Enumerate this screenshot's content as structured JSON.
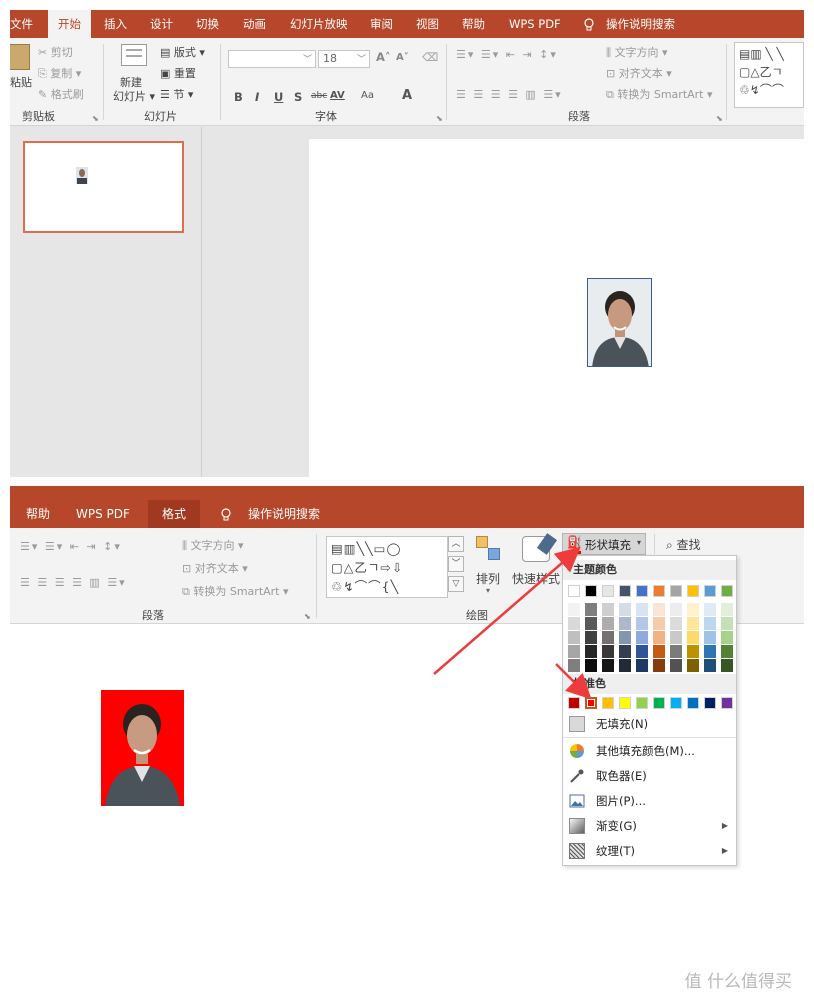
{
  "top_window": {
    "tabs": [
      "文件",
      "开始",
      "插入",
      "设计",
      "切换",
      "动画",
      "幻灯片放映",
      "审阅",
      "视图",
      "帮助",
      "WPS PDF",
      "操作说明搜索"
    ],
    "active_tab": "开始",
    "clipboard": {
      "paste": "粘贴",
      "cut": "剪切",
      "copy": "复制",
      "format_painter": "格式刷",
      "group_label": "剪贴板"
    },
    "slides_group": {
      "new_slide_line1": "新建",
      "new_slide_line2": "幻灯片",
      "layout": "版式",
      "reset": "重置",
      "section": "节",
      "group_label": "幻灯片"
    },
    "font_group": {
      "font_size": "18",
      "letters": [
        "B",
        "I",
        "U",
        "S",
        "abc",
        "AV",
        "Aa",
        "A"
      ],
      "group_label": "字体"
    },
    "paragraph_group": {
      "text_direction": "文字方向",
      "align_text": "对齐文本",
      "convert_smartart": "转换为 SmartArt",
      "group_label": "段落"
    }
  },
  "bottom_window": {
    "tabs": [
      "帮助",
      "WPS PDF",
      "格式",
      "操作说明搜索"
    ],
    "active_tab": "格式",
    "paragraph_group": {
      "text_direction": "文字方向",
      "align_text": "对齐文本",
      "convert_smartart": "转换为 SmartArt",
      "group_label": "段落"
    },
    "drawing_group": {
      "arrange": "排列",
      "quick_styles": "快速样式",
      "shape_fill": "形状填充",
      "find": "查找",
      "group_label": "绘图"
    },
    "fill_menu": {
      "theme_colors_header": "主题颜色",
      "standard_colors_header": "标准色",
      "theme_top_row": [
        "#ffffff",
        "#000000",
        "#e7e6e6",
        "#44546a",
        "#4472c4",
        "#ed7d31",
        "#a5a5a5",
        "#ffc000",
        "#5b9bd5",
        "#70ad47"
      ],
      "theme_shade_columns": [
        [
          "#f2f2f2",
          "#d9d9d9",
          "#bfbfbf",
          "#a6a6a6",
          "#7f7f7f"
        ],
        [
          "#7f7f7f",
          "#595959",
          "#404040",
          "#262626",
          "#0d0d0d"
        ],
        [
          "#d0cece",
          "#aeabab",
          "#757171",
          "#3a3838",
          "#171616"
        ],
        [
          "#d6dce5",
          "#adb9ca",
          "#8497b0",
          "#333f50",
          "#222a35"
        ],
        [
          "#dae3f3",
          "#b4c7e7",
          "#8faadc",
          "#2f5597",
          "#1f3864"
        ],
        [
          "#fbe5d6",
          "#f8cbad",
          "#f4b183",
          "#c55a11",
          "#843c0c"
        ],
        [
          "#ededed",
          "#dbdbdb",
          "#c9c9c9",
          "#7b7b7b",
          "#525252"
        ],
        [
          "#fff2cc",
          "#ffe699",
          "#ffd966",
          "#bf9000",
          "#7f6000"
        ],
        [
          "#deebf7",
          "#bdd7ee",
          "#9dc3e6",
          "#2e75b6",
          "#1f4e79"
        ],
        [
          "#e2f0d9",
          "#c5e0b4",
          "#a9d18e",
          "#548235",
          "#385723"
        ]
      ],
      "standard_colors": [
        "#c00000",
        "#ff0000",
        "#ffc000",
        "#ffff00",
        "#92d050",
        "#00b050",
        "#00b0f0",
        "#0070c0",
        "#002060",
        "#7030a0"
      ],
      "selected_standard_index": 1,
      "items": [
        {
          "label": "无填充(N)",
          "icon": "no-fill-icon",
          "has_submenu": false
        },
        {
          "label": "其他填充颜色(M)...",
          "icon": "color-wheel-icon",
          "has_submenu": false
        },
        {
          "label": "取色器(E)",
          "icon": "eyedropper-icon",
          "has_submenu": false
        },
        {
          "label": "图片(P)...",
          "icon": "picture-icon",
          "has_submenu": false
        },
        {
          "label": "渐变(G)",
          "icon": "gradient-icon",
          "has_submenu": true
        },
        {
          "label": "纹理(T)",
          "icon": "texture-icon",
          "has_submenu": true
        }
      ]
    },
    "photo_background": "#ff0000",
    "accent_arrow_color": "#ee3b3b"
  },
  "watermark": "值 什么值得买",
  "colors": {
    "ribbon_red": "#b7472a",
    "ribbon_bg": "#f3f3f3",
    "thumb_border": "#e06d49"
  }
}
